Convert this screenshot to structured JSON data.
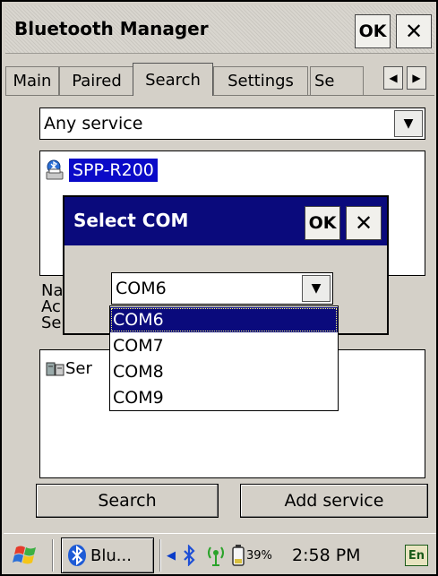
{
  "window": {
    "title": "Bluetooth Manager",
    "ok_label": "OK",
    "close_label": "✕"
  },
  "tabs": [
    {
      "label": "Main"
    },
    {
      "label": "Paired"
    },
    {
      "label": "Search"
    },
    {
      "label": "Settings"
    },
    {
      "label": "Se"
    }
  ],
  "tab_scroll": {
    "left": "◀",
    "right": "▶"
  },
  "service_filter": {
    "value": "Any service",
    "arrow": "▼"
  },
  "devices": [
    {
      "name": "SPP-R200"
    }
  ],
  "details": {
    "name_label": "Na",
    "address_label": "Ac",
    "service_label": "Se"
  },
  "services": [
    {
      "label": "Ser"
    }
  ],
  "buttons": {
    "search": "Search",
    "add_service": "Add service"
  },
  "dialog": {
    "title": "Select COM",
    "ok_label": "OK",
    "close_label": "✕",
    "combo_value": "COM6",
    "combo_arrow": "▼",
    "options": [
      "COM6",
      "COM7",
      "COM8",
      "COM9"
    ],
    "selected_index": 0
  },
  "taskbar": {
    "task_label": "Blu...",
    "tray_arrow": "◀",
    "battery": "39%",
    "time": "2:58 PM",
    "input_method": "En"
  },
  "colors": {
    "selection": "#0a0a7c",
    "highlight": "#0a0ac8",
    "chrome": "#d4d0c8"
  }
}
